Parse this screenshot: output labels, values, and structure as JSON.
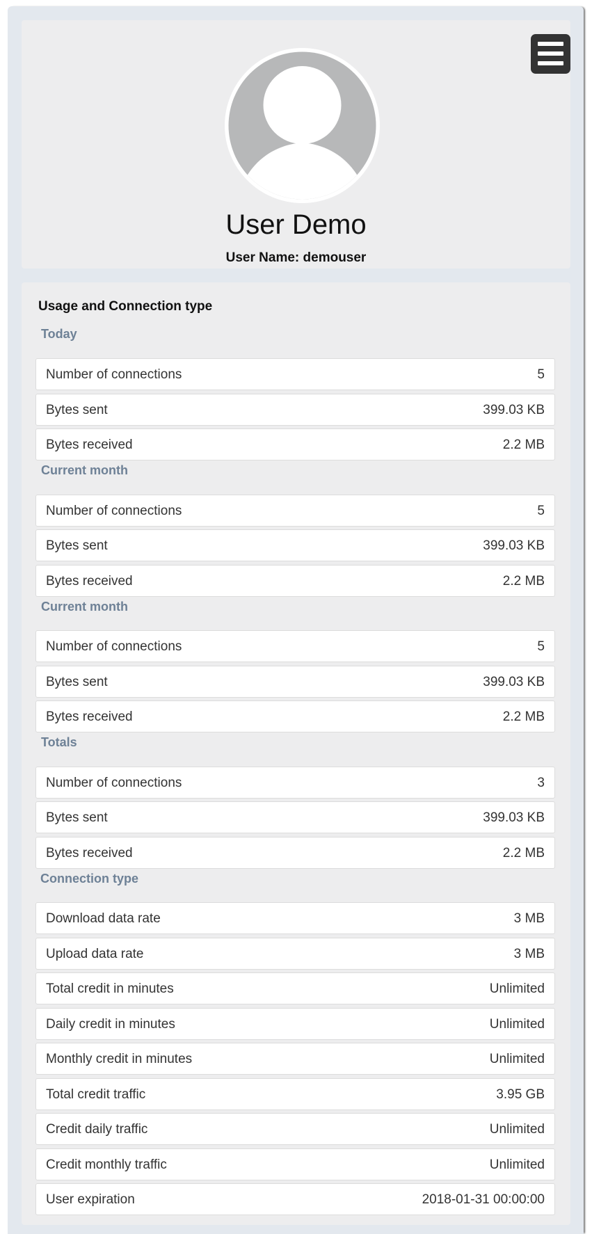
{
  "profile": {
    "full_name": "User Demo",
    "username_line": "User Name: demouser"
  },
  "usage": {
    "title": "Usage and Connection type",
    "sections": [
      {
        "heading": "Today",
        "rows": [
          {
            "label": "Number of connections",
            "value": "5"
          },
          {
            "label": "Bytes sent",
            "value": "399.03 KB"
          },
          {
            "label": "Bytes received",
            "value": "2.2 MB"
          }
        ]
      },
      {
        "heading": "Current month",
        "rows": [
          {
            "label": "Number of connections",
            "value": "5"
          },
          {
            "label": "Bytes sent",
            "value": "399.03 KB"
          },
          {
            "label": "Bytes received",
            "value": "2.2 MB"
          }
        ]
      },
      {
        "heading": "Current month",
        "rows": [
          {
            "label": "Number of connections",
            "value": "5"
          },
          {
            "label": "Bytes sent",
            "value": "399.03 KB"
          },
          {
            "label": "Bytes received",
            "value": "2.2 MB"
          }
        ]
      },
      {
        "heading": "Totals",
        "rows": [
          {
            "label": "Number of connections",
            "value": "3"
          },
          {
            "label": "Bytes sent",
            "value": "399.03 KB"
          },
          {
            "label": "Bytes received",
            "value": "2.2 MB"
          }
        ]
      },
      {
        "heading": "Connection type",
        "rows": [
          {
            "label": "Download data rate",
            "value": "3 MB"
          },
          {
            "label": "Upload data rate",
            "value": "3 MB"
          },
          {
            "label": "Total credit in minutes",
            "value": "Unlimited"
          },
          {
            "label": "Daily credit in minutes",
            "value": "Unlimited"
          },
          {
            "label": "Monthly credit in minutes",
            "value": "Unlimited"
          },
          {
            "label": "Total credit traffic",
            "value": "3.95 GB"
          },
          {
            "label": "Credit daily traffic",
            "value": "Unlimited"
          },
          {
            "label": "Credit monthly traffic",
            "value": "Unlimited"
          },
          {
            "label": "User expiration",
            "value": "2018-01-31 00:00:00"
          }
        ]
      }
    ]
  },
  "icons": {
    "menu": "hamburger-menu-icon",
    "avatar": "user-avatar-icon"
  },
  "colors": {
    "section_heading": "#6e8196",
    "card_background": "#ededee",
    "page_background": "#e3e8ee",
    "menu_button": "#333333"
  }
}
